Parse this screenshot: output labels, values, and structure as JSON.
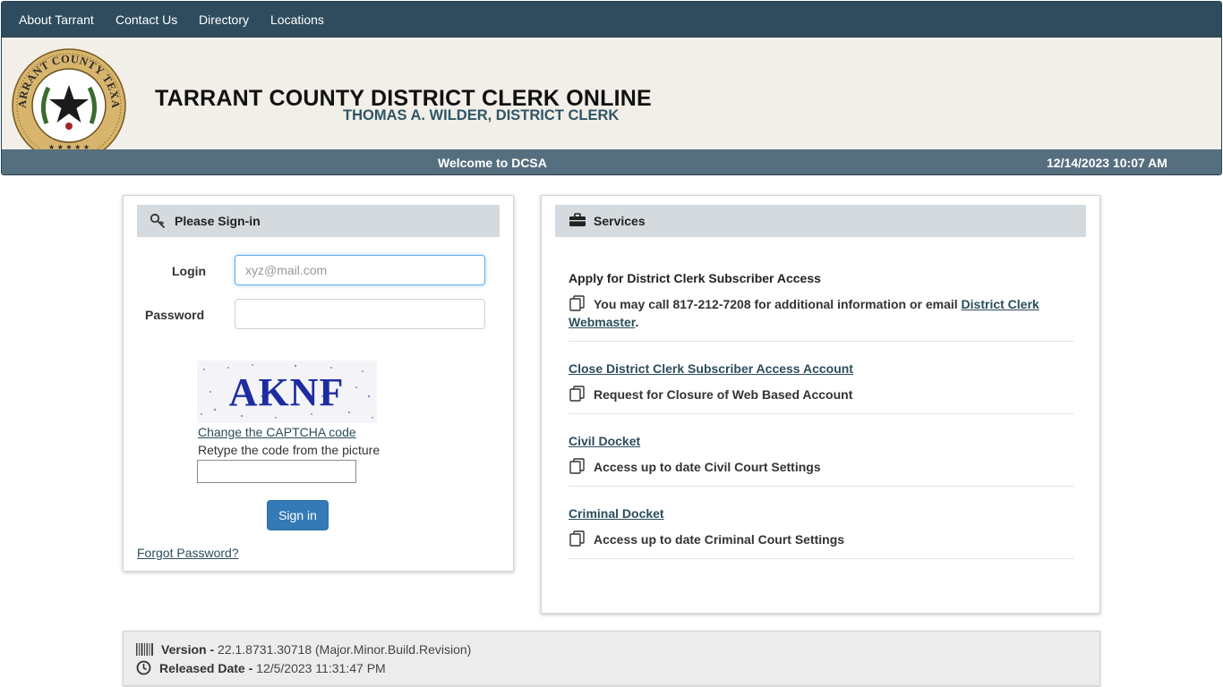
{
  "nav": {
    "items": [
      "About Tarrant",
      "Contact Us",
      "Directory",
      "Locations"
    ]
  },
  "banner": {
    "seal_text": "TARRANT COUNTY TEXAS",
    "title": "TARRANT COUNTY DISTRICT CLERK ONLINE",
    "subtitle": "THOMAS A. WILDER, DISTRICT CLERK"
  },
  "status_bar": {
    "welcome": "Welcome to DCSA",
    "datetime": "12/14/2023 10:07 AM"
  },
  "signin": {
    "heading": "Please Sign-in",
    "login_label": "Login",
    "login_placeholder": "xyz@mail.com",
    "password_label": "Password",
    "captcha_code": "AKNF",
    "captcha_change": "Change the CAPTCHA code",
    "captcha_hint": "Retype the code from the picture",
    "button": "Sign in",
    "forgot": "Forgot Password?"
  },
  "services": {
    "heading": "Services",
    "items": [
      {
        "title": "Apply for District Clerk Subscriber Access",
        "desc": "You may call 817-212-7208 for additional information or email ",
        "link": "District Clerk Webmaster",
        "after": "."
      },
      {
        "title": "Close District Clerk Subscriber Access Account",
        "desc": "Request for Closure of Web Based Account"
      },
      {
        "title": "Civil Docket",
        "desc": "Access up to date Civil Court Settings"
      },
      {
        "title": "Criminal Docket",
        "desc": "Access up to date Criminal Court Settings"
      }
    ]
  },
  "footer": {
    "version_label": "Version -",
    "version_value": "22.1.8731.30718 (Major.Minor.Build.Revision)",
    "released_label": "Released Date -",
    "released_value": "12/5/2023 11:31:47 PM"
  },
  "colors": {
    "nav_bg": "#2e4c5d",
    "banner_bg": "#f2efe9",
    "status_bg": "#566f7e",
    "primary_button": "#337ab7",
    "link": "#2b4d5c"
  }
}
